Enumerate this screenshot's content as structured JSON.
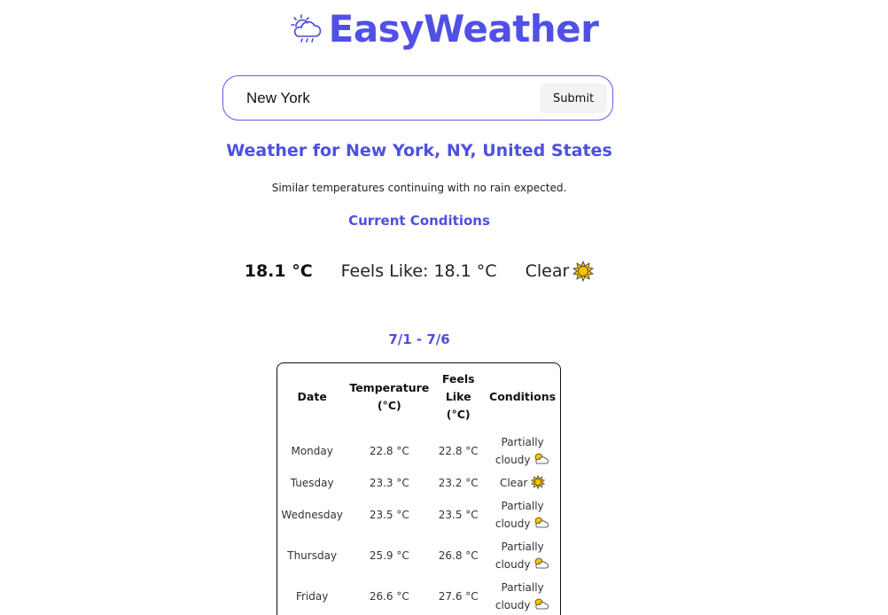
{
  "app": {
    "brand": "EasyWeather",
    "logo_icon": "cloud-rain-sun-icon"
  },
  "search": {
    "value": "New York",
    "submit_label": "Submit"
  },
  "location_title": "Weather for New York, NY, United States",
  "summary": "Similar temperatures continuing with no rain expected.",
  "current": {
    "heading": "Current Conditions",
    "temp": "18.1 °C",
    "feels_like": "Feels Like: 18.1 °C",
    "condition": "Clear",
    "condition_icon": "sun-icon"
  },
  "forecast": {
    "range": "7/1 - 7/6",
    "columns": {
      "date": "Date",
      "temp_line1": "Temperature",
      "temp_line2": "(°C)",
      "feels_line1": "Feels",
      "feels_line2": "Like",
      "feels_line3": "(°C)",
      "conditions": "Conditions"
    },
    "rows": [
      {
        "day": "Monday",
        "temp": "22.8 °C",
        "feels": "22.8 °C",
        "cond_line1": "Partially",
        "cond_line2": "cloudy",
        "icon": "partly-cloudy-icon"
      },
      {
        "day": "Tuesday",
        "temp": "23.3 °C",
        "feels": "23.2 °C",
        "cond_line1": "Clear",
        "cond_line2": "",
        "icon": "sun-icon"
      },
      {
        "day": "Wednesday",
        "temp": "23.5 °C",
        "feels": "23.5 °C",
        "cond_line1": "Partially",
        "cond_line2": "cloudy",
        "icon": "partly-cloudy-icon"
      },
      {
        "day": "Thursday",
        "temp": "25.9 °C",
        "feels": "26.8 °C",
        "cond_line1": "Partially",
        "cond_line2": "cloudy",
        "icon": "partly-cloudy-icon"
      },
      {
        "day": "Friday",
        "temp": "26.6 °C",
        "feels": "27.6 °C",
        "cond_line1": "Partially",
        "cond_line2": "cloudy",
        "icon": "partly-cloudy-icon"
      }
    ]
  },
  "colors": {
    "accent": "#5050e6",
    "sun": "#f5c400",
    "text": "#111111"
  }
}
